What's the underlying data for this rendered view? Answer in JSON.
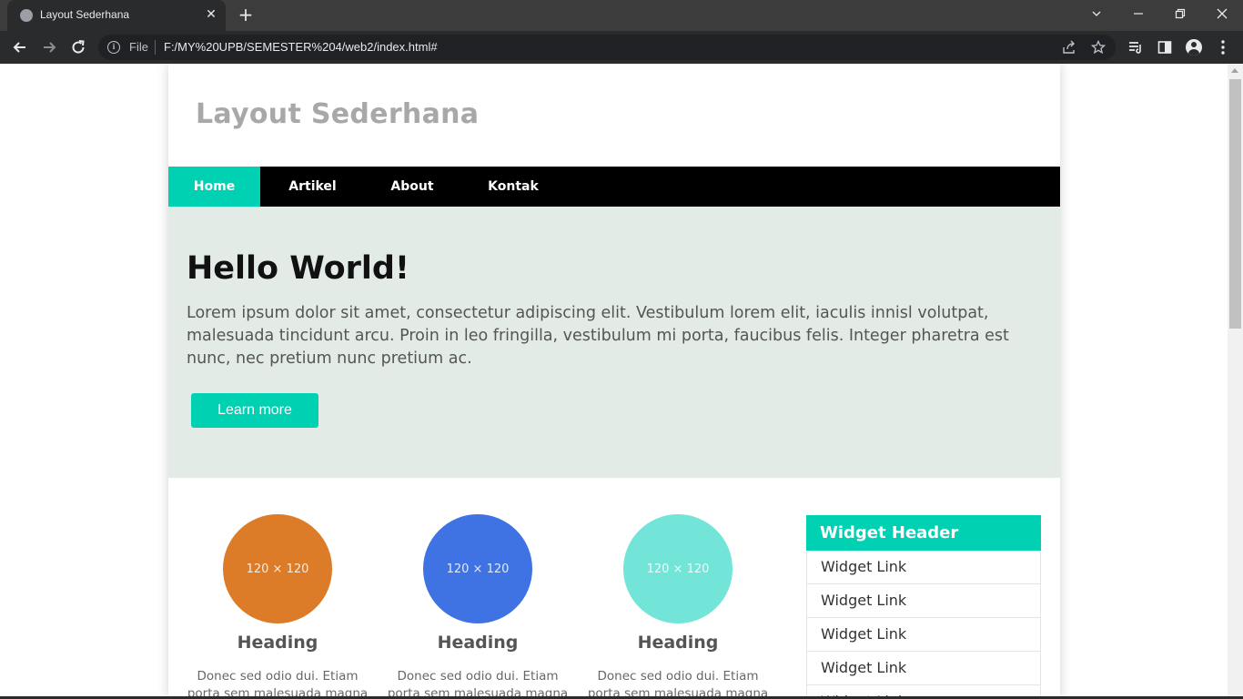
{
  "browser": {
    "tab_title": "Layout Sederhana",
    "address_scheme_label": "File",
    "url": "F:/MY%20UPB/SEMESTER%204/web2/index.html#"
  },
  "site": {
    "title": "Layout Sederhana",
    "nav": [
      {
        "label": "Home",
        "active": true
      },
      {
        "label": "Artikel",
        "active": false
      },
      {
        "label": "About",
        "active": false
      },
      {
        "label": "Kontak",
        "active": false
      }
    ],
    "hero": {
      "title": "Hello World!",
      "text": "Lorem ipsum dolor sit amet, consectetur adipiscing elit. Vestibulum lorem elit, iaculis innisl volutpat, malesuada tincidunt arcu. Proin in leo fringilla, vestibulum mi porta, faucibus felis. Integer pharetra est nunc, nec pretium nunc pretium ac.",
      "button_label": "Learn more"
    },
    "features": [
      {
        "image_label": "120 × 120",
        "color": "#dc7c28",
        "heading": "Heading",
        "text": "Donec sed odio dui. Etiam porta sem malesuada magna"
      },
      {
        "image_label": "120 × 120",
        "color": "#3f72e2",
        "heading": "Heading",
        "text": "Donec sed odio dui. Etiam porta sem malesuada magna"
      },
      {
        "image_label": "120 × 120",
        "color": "#72e5d8",
        "heading": "Heading",
        "text": "Donec sed odio dui. Etiam porta sem malesuada magna"
      }
    ],
    "widget": {
      "header": "Widget Header",
      "links": [
        "Widget Link",
        "Widget Link",
        "Widget Link",
        "Widget Link",
        "Widget Link"
      ]
    }
  },
  "colors": {
    "accent": "#00d1b2",
    "nav_bg": "#000000",
    "hero_bg": "#e2ebe6"
  }
}
